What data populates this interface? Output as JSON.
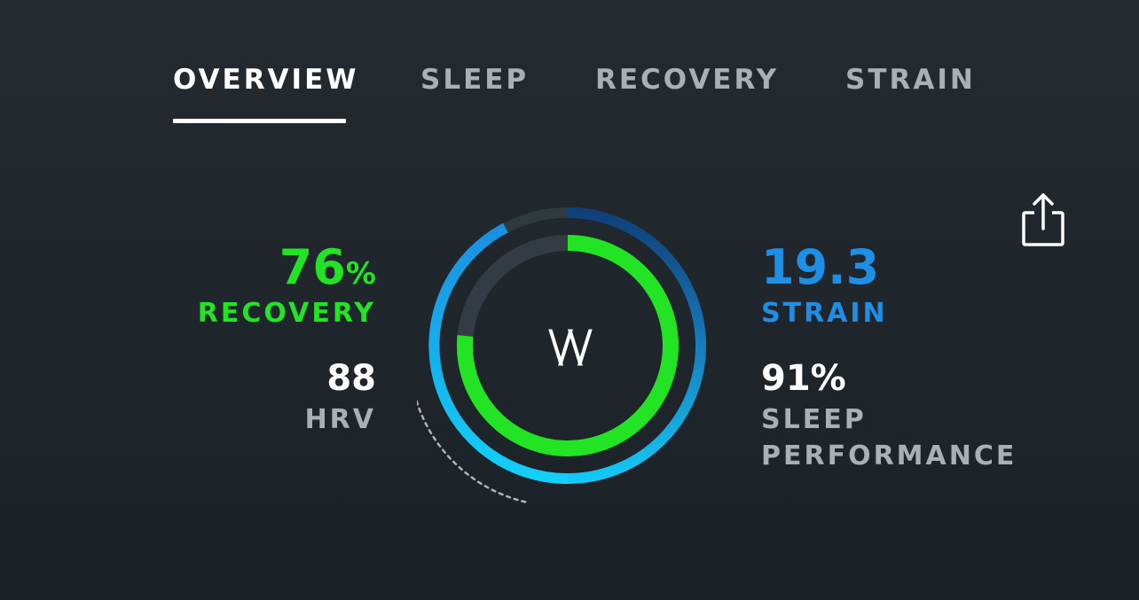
{
  "tabs": [
    {
      "label": "OVERVIEW",
      "active": true
    },
    {
      "label": "SLEEP",
      "active": false
    },
    {
      "label": "RECOVERY",
      "active": false
    },
    {
      "label": "STRAIN",
      "active": false
    }
  ],
  "share_icon": "share-icon",
  "recovery": {
    "value": "76",
    "unit": "%",
    "label": "RECOVERY",
    "percent": 76
  },
  "hrv": {
    "value": "88",
    "label": "HRV"
  },
  "strain": {
    "value": "19.3",
    "label": "STRAIN",
    "level_fraction": 0.9
  },
  "sleep_performance": {
    "value": "91%",
    "label_line1": "SLEEP",
    "label_line2": "PERFORMANCE"
  },
  "logo_text": "\\/\\/",
  "colors": {
    "recovery_green": "#22e324",
    "strain_blue": "#1d8fe4",
    "background": "#1f262c"
  }
}
